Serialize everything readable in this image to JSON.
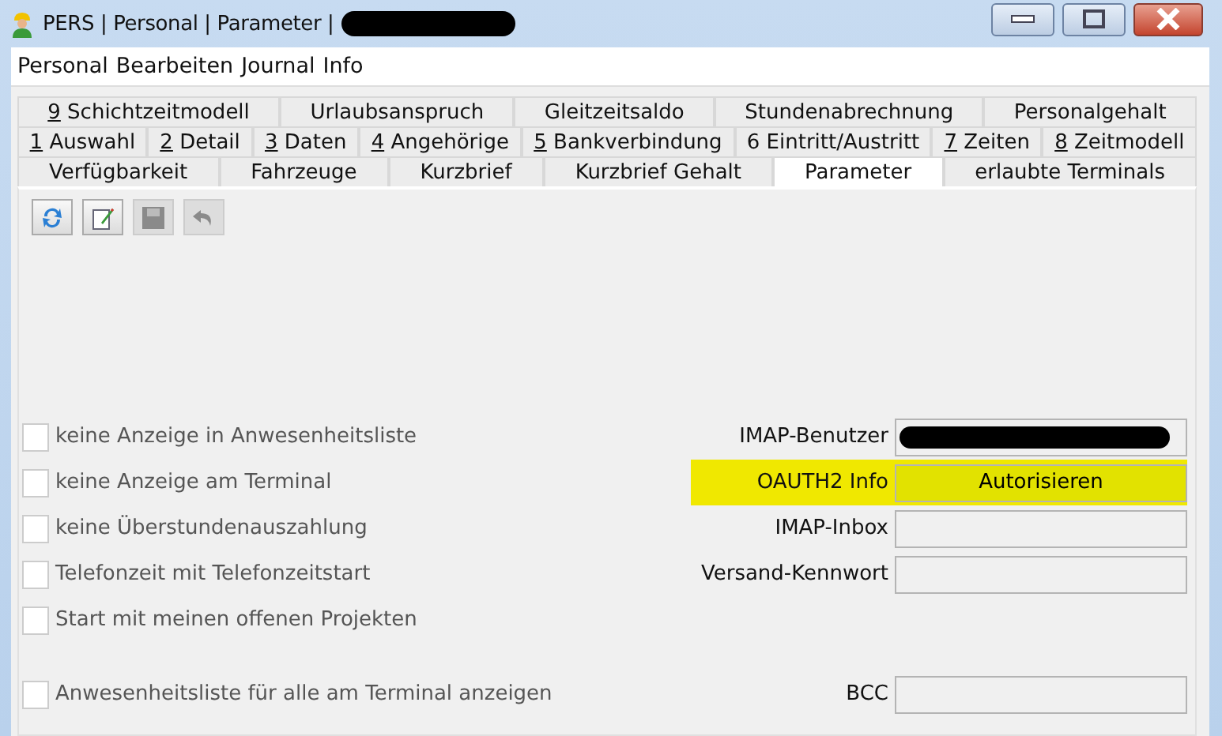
{
  "window": {
    "title": "PERS | Personal | Parameter |"
  },
  "menu": [
    "Personal",
    "Bearbeiten",
    "Journal",
    "Info"
  ],
  "tab_rows": [
    [
      {
        "label": "9 Schichtzeitmodell",
        "mnemonic": true,
        "selected": false
      },
      {
        "label": "Urlaubsanspruch",
        "mnemonic": false,
        "selected": false
      },
      {
        "label": "Gleitzeitsaldo",
        "mnemonic": false,
        "selected": false
      },
      {
        "label": "Stundenabrechnung",
        "mnemonic": false,
        "selected": false
      },
      {
        "label": "Personalgehalt",
        "mnemonic": false,
        "selected": false
      }
    ],
    [
      {
        "label": "1 Auswahl",
        "mnemonic": true,
        "selected": false
      },
      {
        "label": "2 Detail",
        "mnemonic": true,
        "selected": false
      },
      {
        "label": "3 Daten",
        "mnemonic": true,
        "selected": false
      },
      {
        "label": "4 Angehörige",
        "mnemonic": true,
        "selected": false
      },
      {
        "label": "5 Bankverbindung",
        "mnemonic": true,
        "selected": false
      },
      {
        "label": "6 Eintritt/Austritt",
        "mnemonic": false,
        "selected": false
      },
      {
        "label": "7 Zeiten",
        "mnemonic": true,
        "selected": false
      },
      {
        "label": "8 Zeitmodell",
        "mnemonic": true,
        "selected": false
      }
    ],
    [
      {
        "label": "Verfügbarkeit",
        "mnemonic": false,
        "selected": false
      },
      {
        "label": "Fahrzeuge",
        "mnemonic": false,
        "selected": false
      },
      {
        "label": "Kurzbrief",
        "mnemonic": false,
        "selected": false
      },
      {
        "label": "Kurzbrief Gehalt",
        "mnemonic": false,
        "selected": false
      },
      {
        "label": "Parameter",
        "mnemonic": false,
        "selected": true
      },
      {
        "label": "erlaubte Terminals",
        "mnemonic": false,
        "selected": false
      }
    ]
  ],
  "toolbar": [
    {
      "kind": "refresh",
      "disabled": false
    },
    {
      "kind": "edit",
      "disabled": false
    },
    {
      "kind": "save",
      "disabled": true
    },
    {
      "kind": "undo",
      "disabled": true
    }
  ],
  "checkboxes": [
    {
      "label": "keine Anzeige in Anwesenheitsliste",
      "checked": false
    },
    {
      "label": "keine Anzeige am Terminal",
      "checked": false
    },
    {
      "label": "keine Überstundenauszahlung",
      "checked": false
    },
    {
      "label": "Telefonzeit mit Telefonzeitstart",
      "checked": false
    },
    {
      "label": "Start mit meinen offenen Projekten",
      "checked": false
    },
    {
      "label": "Anwesenheitsliste für alle am Terminal anzeigen",
      "checked": false
    }
  ],
  "fields": [
    {
      "label": "IMAP-Benutzer",
      "kind": "redacted",
      "highlighted": false
    },
    {
      "label": "OAUTH2 Info",
      "kind": "button",
      "value": "Autorisieren",
      "highlighted": true
    },
    {
      "label": "IMAP-Inbox",
      "kind": "text",
      "highlighted": false
    },
    {
      "label": "Versand-Kennwort",
      "kind": "text",
      "highlighted": false
    },
    {
      "label": "BCC",
      "kind": "text",
      "highlighted": false
    }
  ]
}
